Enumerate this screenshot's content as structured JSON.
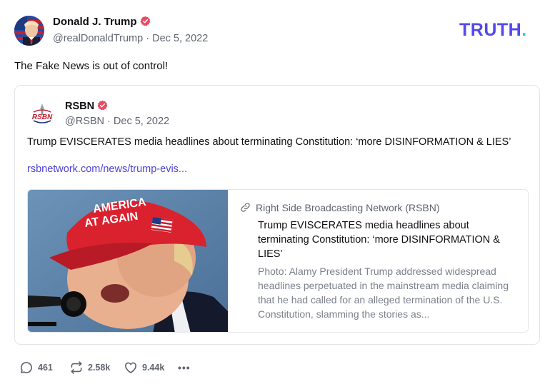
{
  "author": {
    "name": "Donald J. Trump",
    "handle": "@realDonaldTrump",
    "separator": "·",
    "date": "Dec 5, 2022",
    "verified": true
  },
  "brand": {
    "logo_text": "TRUTH",
    "logo_dot": ".",
    "primary_color": "#5448ee",
    "dot_color": "#1bd8c4"
  },
  "status_text": "The Fake News is out of control!",
  "quote": {
    "author_name": "RSBN",
    "avatar_text": "RSBN",
    "handle": "@RSBN",
    "separator": "·",
    "date": "Dec 5, 2022",
    "verified": true,
    "text": "Trump EVISCERATES media headlines about terminating Constitution: ‘more DISINFORMATION & LIES’",
    "link": "rsbnetwork.com/news/trump-evis...",
    "card": {
      "image_caption_line1": "AMERICA",
      "image_caption_line2": "AT AGAIN",
      "source": "Right Side Broadcasting Network (RSBN)",
      "title": "Trump EVISCERATES media headlines about terminating Constitution: ‘more DISINFORMATION & LIES’",
      "description": "Photo: Alamy President Trump addressed widespread headlines perpetuated in the mainstream media claiming that he had called for an alleged termination of the U.S. Constitution, slamming the stories as..."
    }
  },
  "actions": {
    "replies": "461",
    "retruths": "2.58k",
    "likes": "9.44k",
    "more": "•••"
  },
  "colors": {
    "verified": "#e84c64",
    "link": "#4c43d8",
    "muted": "#5f6470"
  },
  "icons": [
    "verified-badge-icon",
    "link-icon",
    "reply-icon",
    "retruth-icon",
    "like-icon",
    "more-icon"
  ]
}
